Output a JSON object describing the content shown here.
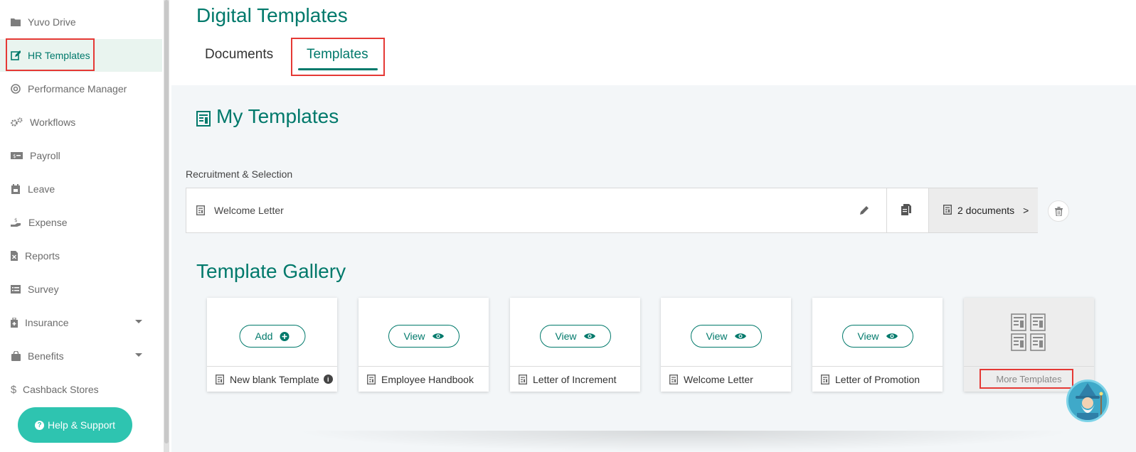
{
  "sidebar": {
    "items": [
      {
        "label": "Yuvo Drive",
        "icon": "folder-icon"
      },
      {
        "label": "HR Templates",
        "icon": "edit-icon"
      },
      {
        "label": "Performance Manager",
        "icon": "target-icon"
      },
      {
        "label": "Workflows",
        "icon": "gears-icon"
      },
      {
        "label": "Payroll",
        "icon": "money-icon"
      },
      {
        "label": "Leave",
        "icon": "calendar-icon"
      },
      {
        "label": "Expense",
        "icon": "hand-coin-icon"
      },
      {
        "label": "Reports",
        "icon": "excel-file-icon"
      },
      {
        "label": "Survey",
        "icon": "list-icon"
      },
      {
        "label": "Insurance",
        "icon": "medkit-icon"
      },
      {
        "label": "Benefits",
        "icon": "bag-icon"
      },
      {
        "label": "Cashback Stores",
        "icon": "dollar-icon"
      }
    ],
    "active": "HR Templates",
    "help_label": "Help & Support"
  },
  "header": {
    "title": "Digital Templates",
    "tabs": [
      {
        "label": "Documents"
      },
      {
        "label": "Templates"
      }
    ],
    "active_tab": "Templates"
  },
  "my_templates": {
    "title": "My Templates",
    "category": "Recruitment & Selection",
    "rows": [
      {
        "name": "Welcome Letter",
        "docs_label": "2 documents",
        "arrow": ">"
      }
    ]
  },
  "gallery": {
    "title": "Template Gallery",
    "cards": [
      {
        "button": "Add",
        "name": "New blank Template"
      },
      {
        "button": "View",
        "name": "Employee Handbook"
      },
      {
        "button": "View",
        "name": "Letter of Increment"
      },
      {
        "button": "View",
        "name": "Welcome Letter"
      },
      {
        "button": "View",
        "name": "Letter of Promotion"
      }
    ],
    "more_label": "More Templates"
  },
  "colors": {
    "accent": "#00796b",
    "help_button": "#2ec4b0",
    "highlight": "#e53935",
    "active_bg": "#e9f4ef"
  }
}
